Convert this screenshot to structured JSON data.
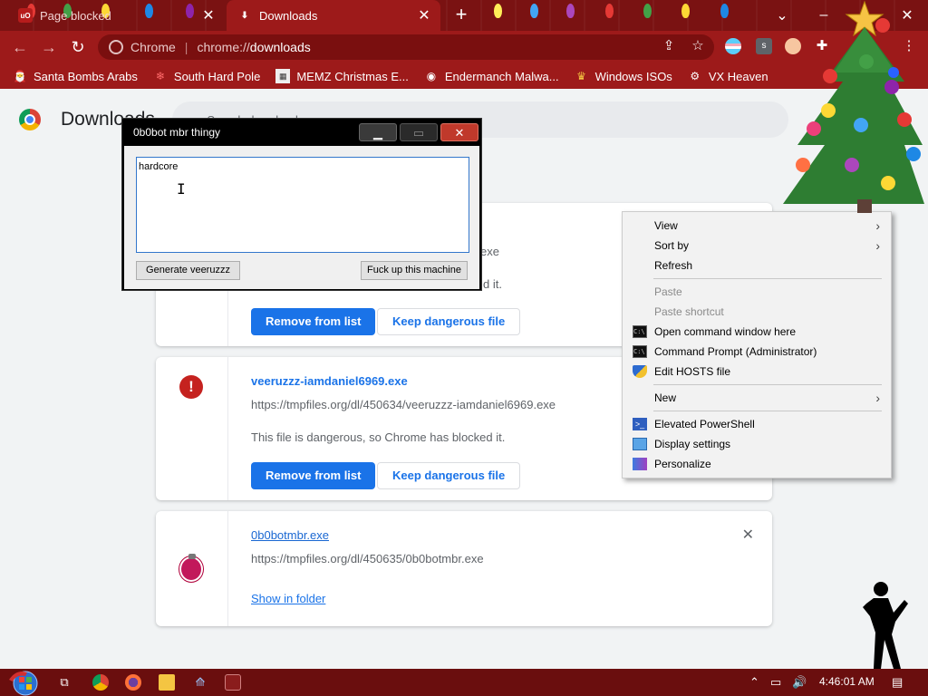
{
  "window": {
    "tabs": [
      {
        "label": "Page blocked",
        "active": false
      },
      {
        "label": "Downloads",
        "active": true
      }
    ]
  },
  "toolbar": {
    "site_name": "Chrome",
    "url_scheme": "chrome://",
    "url_path": "downloads"
  },
  "bookmarks": [
    {
      "label": "Santa Bombs Arabs",
      "icon": "santa-icon"
    },
    {
      "label": "South Hard Pole",
      "icon": "snowflake-icon"
    },
    {
      "label": "MEMZ Christmas E...",
      "icon": "memz-icon"
    },
    {
      "label": "Endermanch Malwa...",
      "icon": "raccoon-icon"
    },
    {
      "label": "Windows ISOs",
      "icon": "trophy-icon"
    },
    {
      "label": "VX Heaven",
      "icon": "vx-icon"
    }
  ],
  "page": {
    "title": "Downloads",
    "search_placeholder": "Search downloads"
  },
  "downloads": [
    {
      "filename": "veeruzzz-iamdaniel6969.exe",
      "url": "https://tmpfiles.org/dl/450634/veeruzzz-iamdaniel6969.exe",
      "status": "This file is dangerous, so Chrome has blocked it.",
      "remove_label": "Remove from list",
      "keep_label": "Keep dangerous file",
      "partial_url_tail": "exe",
      "partial_status_tail": "d it."
    },
    {
      "filename": "0b0botmbr.exe",
      "url": "https://tmpfiles.org/dl/450635/0b0botmbr.exe",
      "action_label": "Show in folder"
    }
  ],
  "dialog": {
    "title": "0b0bot mbr thingy",
    "textbox_value": "hardcore",
    "generate_label": "Generate veeruzzz",
    "destroy_label": "Fuck up this machine"
  },
  "context_menu": {
    "items": [
      {
        "label": "View",
        "submenu": true
      },
      {
        "label": "Sort by",
        "submenu": true
      },
      {
        "label": "Refresh"
      },
      {
        "label": "Paste",
        "disabled": true
      },
      {
        "label": "Paste shortcut",
        "disabled": true
      },
      {
        "label": "Open command window here",
        "icon": "cmd-icon"
      },
      {
        "label": "Command Prompt (Administrator)",
        "icon": "cmd-icon"
      },
      {
        "label": "Edit HOSTS file",
        "icon": "shield-icon"
      },
      {
        "label": "New",
        "submenu": true
      },
      {
        "label": "Elevated PowerShell",
        "icon": "powershell-icon"
      },
      {
        "label": "Display settings",
        "icon": "display-icon"
      },
      {
        "label": "Personalize",
        "icon": "personalize-icon"
      }
    ]
  },
  "taskbar": {
    "clock": "4:46:01 AM"
  },
  "colors": {
    "chrome_frame": "#9d1a1a",
    "accent_blue": "#1a73e8",
    "danger_red": "#c5221f",
    "taskbar": "#6a0e0e"
  }
}
